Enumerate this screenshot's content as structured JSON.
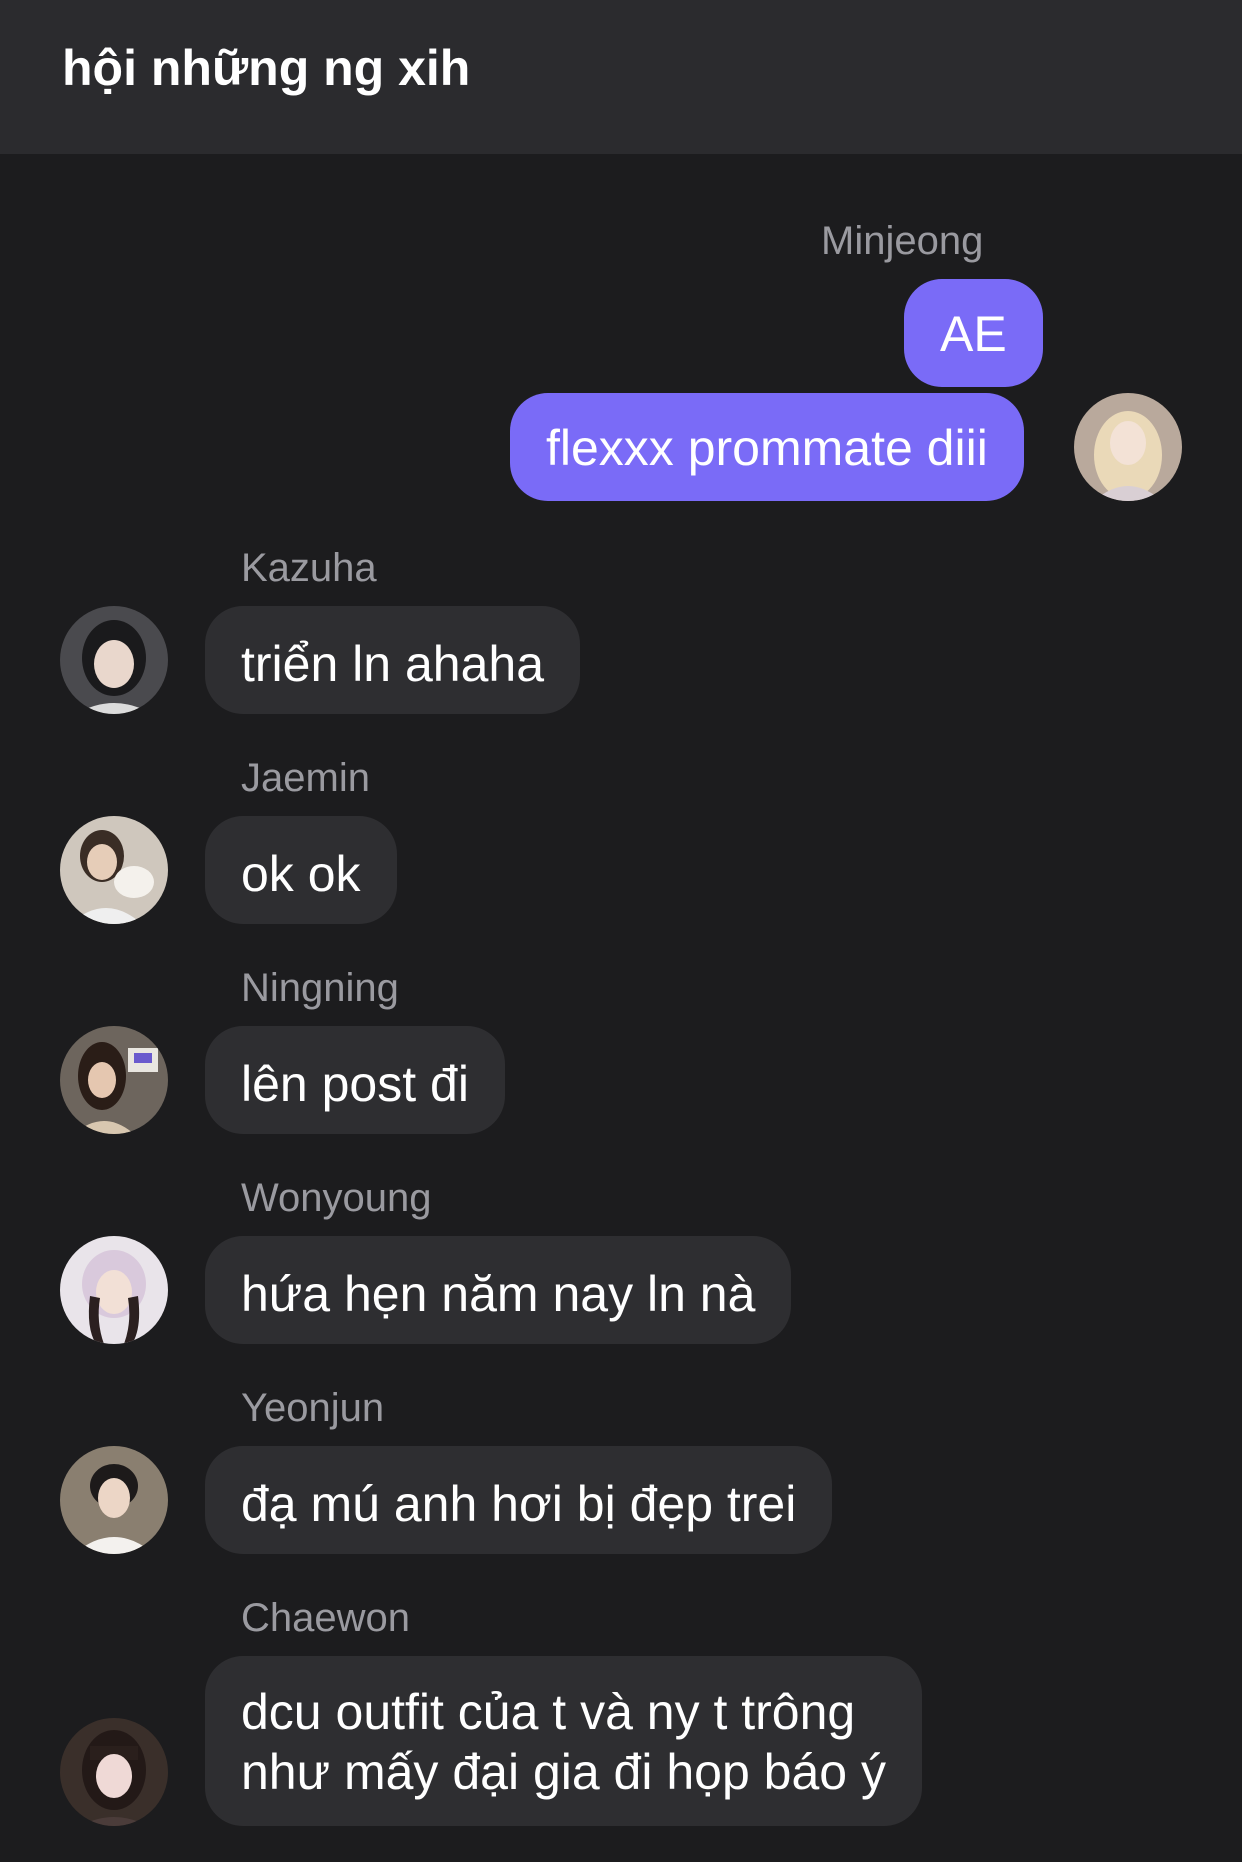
{
  "header": {
    "title": "hội những ng xih"
  },
  "messages": {
    "minjeong": {
      "sender": "Minjeong",
      "texts": [
        "AE",
        "flexxx prommate diii"
      ]
    },
    "kazuha": {
      "sender": "Kazuha",
      "text": "triển ln ahaha"
    },
    "jaemin": {
      "sender": "Jaemin",
      "text": "ok ok"
    },
    "ningning": {
      "sender": "Ningning",
      "text": "lên post đi"
    },
    "wonyoung": {
      "sender": "Wonyoung",
      "text": "hứa hẹn năm nay ln nà"
    },
    "yeonjun": {
      "sender": "Yeonjun",
      "text": "đạ mú anh hơi bị đẹp trei"
    },
    "chaewon": {
      "sender": "Chaewon",
      "lines": [
        "dcu outfit của t và ny t trông",
        "như mấy đại gia đi họp báo ý"
      ]
    }
  },
  "colors": {
    "background": "#1c1c1e",
    "header": "#2b2b2e",
    "bubble_incoming": "#2e2e31",
    "bubble_outgoing": "#7a6bf7",
    "sender_name": "#9a9aa0"
  }
}
